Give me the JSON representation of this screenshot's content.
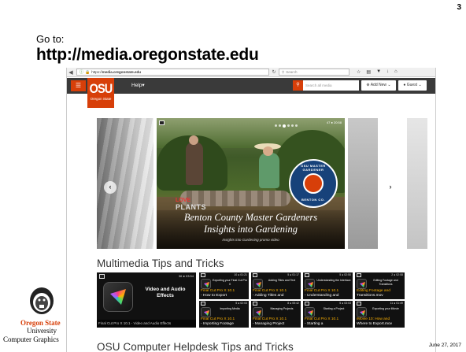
{
  "slide": {
    "number": "3",
    "goto_label": "Go to:",
    "url_title": "http://media.oregonstate.edu",
    "footer_org": "Oregon State",
    "footer_univ": "University",
    "footer_dept": "Computer Graphics",
    "footer_date": "June 27, 2017"
  },
  "browser": {
    "address_scheme": "https://",
    "address_host": "media.oregonstate.edu",
    "search_placeholder": "Search",
    "toolbar_icons": [
      "star-icon",
      "reading-list-icon",
      "pocket-icon",
      "download-icon",
      "home-icon"
    ]
  },
  "site": {
    "logo_text": "OSU",
    "logo_subtext": "Oregon State",
    "help_label": "Help",
    "search_placeholder": "Search all media",
    "add_new_label": "Add New",
    "guest_label": "Guest"
  },
  "carousel": {
    "meta": "47 ● 20:58",
    "love": "LOVE",
    "plants": "PLANTS",
    "seal_top": "OSU MASTER GARDENER",
    "seal_bottom": "BENTON CO.",
    "caption_line1": "Benton County Master Gardeners",
    "caption_line2": "Insights into Gardening",
    "caption_line3": "Insights into Gardening promo video"
  },
  "sections": {
    "multimedia_title": "Multimedia Tips and Tricks",
    "helpdesk_title": "OSU Computer Helpdesk Tips and Tricks"
  },
  "featured": {
    "title": "Video and Audio Effects",
    "meta": "36 ● 03:54",
    "caption": "Final Cut Pro X 10.1 - Video and Audio Effects"
  },
  "tiles": [
    {
      "meta": "10 ● 01:21",
      "mini": "Exporting your Final Cut Pro X",
      "cap1": "Final Cut Pro X 10.1",
      "cap2": "- How to Export"
    },
    {
      "meta": "5 ● 01:17",
      "mini": "Adding Titles and Text",
      "cap1": "Final Cut Pro X 10.1",
      "cap2": "- Adding Titles and"
    },
    {
      "meta": "5 ● 02:50",
      "mini": "Understanding the Interface",
      "cap1": "Final Cut Pro X 10.1",
      "cap2": "- Understanding and"
    },
    {
      "meta": "2 ● 02:08",
      "mini": "Editing Footage and Transitions",
      "cap1": "Editing Footage and",
      "cap2": "Transitions.mov"
    },
    {
      "meta": "5 ● 02:03",
      "mini": "Importing Media",
      "cap1": "Final Cut Pro X 10.1",
      "cap2": "- Importing Footage"
    },
    {
      "meta": "8 ● 05:42",
      "mini": "Managing Projects",
      "cap1": "Final Cut Pro X 10.1",
      "cap2": "- Managing Project"
    },
    {
      "meta": "5 ● 03:03",
      "mini": "Starting a Project",
      "cap1": "Final Cut Pro X 10.1",
      "cap2": "- Starting a"
    },
    {
      "meta": "11 ● 01:49",
      "mini": "Exporting your iMovie",
      "cap1": "iMovie 10: How and",
      "cap2": "Where to Export.mov"
    }
  ]
}
